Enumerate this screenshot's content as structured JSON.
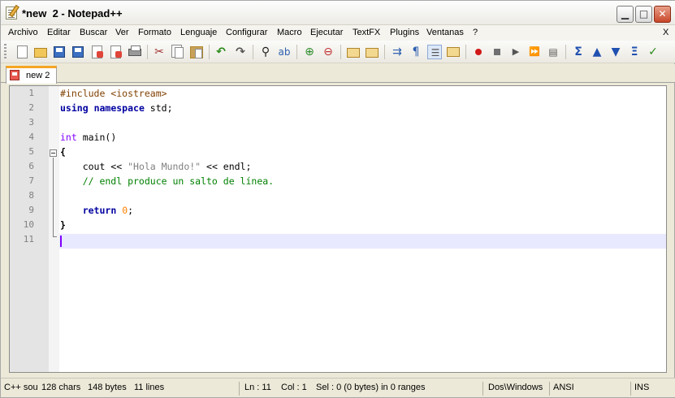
{
  "window": {
    "title": "*new  2 - Notepad++"
  },
  "window_buttons": {
    "minimize": "▁",
    "maximize": "□",
    "close": "✕"
  },
  "menu": {
    "items": [
      "Archivo",
      "Editar",
      "Buscar",
      "Ver",
      "Formato",
      "Lenguaje",
      "Configurar",
      "Macro",
      "Ejecutar",
      "TextFX",
      "Plugins",
      "Ventanas",
      "?"
    ],
    "close": "X"
  },
  "toolbar": {
    "icons": [
      "new-icon",
      "open-icon",
      "save-icon",
      "save-all-icon",
      "close-icon",
      "close-all-icon",
      "print-icon",
      "cut-icon",
      "copy-icon",
      "paste-icon",
      "undo-icon",
      "redo-icon",
      "find-icon",
      "replace-icon",
      "zoom-in-icon",
      "zoom-out-icon",
      "sync-vertical-icon",
      "sync-horizontal-icon",
      "word-wrap-icon",
      "show-all-chars-icon",
      "indent-guide-icon",
      "user-lang-icon",
      "record-macro-icon",
      "stop-macro-icon",
      "play-macro-icon",
      "run-macro-multiple-icon",
      "save-macro-icon",
      "textfx-icon",
      "previous-icon",
      "next-icon",
      "textfx-sort-icon",
      "spellcheck-icon"
    ]
  },
  "tab": {
    "label": "new 2"
  },
  "editor": {
    "line_numbers": [
      "1",
      "2",
      "3",
      "4",
      "5",
      "6",
      "7",
      "8",
      "9",
      "10",
      "11"
    ],
    "lines": [
      [
        {
          "t": "#include <iostream>",
          "c": "pre"
        }
      ],
      [
        {
          "t": "using",
          "c": "kw"
        },
        {
          "t": " ",
          "c": ""
        },
        {
          "t": "namespace",
          "c": "kw"
        },
        {
          "t": " std;",
          "c": ""
        }
      ],
      [],
      [
        {
          "t": "int",
          "c": "type"
        },
        {
          "t": " main()",
          "c": ""
        }
      ],
      [
        {
          "t": "{",
          "c": "bold"
        }
      ],
      [
        {
          "t": "    cout << ",
          "c": ""
        },
        {
          "t": "\"Hola Mundo!\"",
          "c": "str"
        },
        {
          "t": " << endl;",
          "c": ""
        }
      ],
      [
        {
          "t": "    // endl produce un salto de línea.",
          "c": "com"
        }
      ],
      [],
      [
        {
          "t": "    ",
          "c": ""
        },
        {
          "t": "return",
          "c": "kw"
        },
        {
          "t": " ",
          "c": ""
        },
        {
          "t": "0",
          "c": "num"
        },
        {
          "t": ";",
          "c": ""
        }
      ],
      [
        {
          "t": "}",
          "c": "bold"
        }
      ],
      []
    ]
  },
  "status": {
    "lang": "C++ sou",
    "chars": "128 chars",
    "bytes": "148 bytes",
    "lines": "11 lines",
    "ln": "Ln : 11",
    "col": "Col : 1",
    "sel": "Sel : 0 (0 bytes) in 0 ranges",
    "eol": "Dos\\Windows",
    "encoding": "ANSI",
    "mode": "INS"
  },
  "colors": {
    "preprocessor": "#804000",
    "keyword": "#0000a0",
    "type": "#8000ff",
    "string": "#808080",
    "comment": "#008000",
    "number": "#ff8000",
    "current_line": "#e8e8ff",
    "tab_accent": "#f5a623"
  }
}
